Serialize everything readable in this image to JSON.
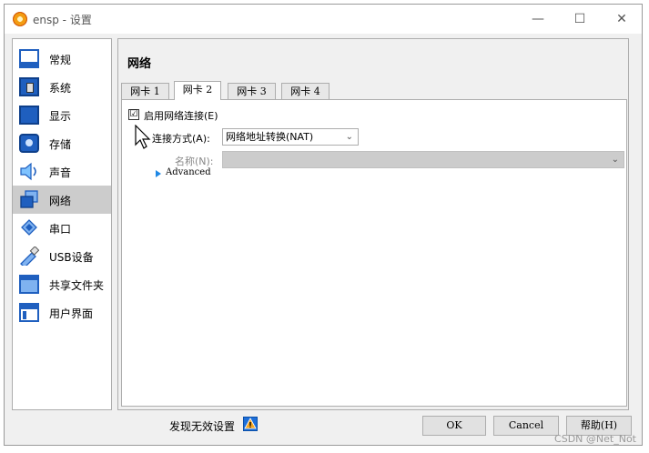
{
  "window": {
    "title": "ensp - 设置",
    "controls": {
      "minimize": "—",
      "maximize": "☐",
      "close": "✕"
    }
  },
  "sidebar": {
    "items": [
      {
        "label": "常规",
        "icon": "general-icon"
      },
      {
        "label": "系统",
        "icon": "system-icon"
      },
      {
        "label": "显示",
        "icon": "display-icon"
      },
      {
        "label": "存储",
        "icon": "storage-icon"
      },
      {
        "label": "声音",
        "icon": "audio-icon"
      },
      {
        "label": "网络",
        "icon": "network-icon",
        "selected": true
      },
      {
        "label": "串口",
        "icon": "serial-port-icon"
      },
      {
        "label": "USB设备",
        "icon": "usb-icon"
      },
      {
        "label": "共享文件夹",
        "icon": "shared-folder-icon"
      },
      {
        "label": "用户界面",
        "icon": "user-interface-icon"
      }
    ]
  },
  "main": {
    "title": "网络",
    "tabs": [
      {
        "label": "网卡 1"
      },
      {
        "label": "网卡 2",
        "active": true
      },
      {
        "label": "网卡 3"
      },
      {
        "label": "网卡 4"
      }
    ],
    "enable_label": "启用网络连接(E)",
    "enable_checked": "☑",
    "attached_label": "连接方式(A):",
    "attached_value": "网络地址转换(NAT)",
    "name_label": "名称(N):",
    "name_value": "",
    "advanced_label": "Advanced"
  },
  "footer": {
    "invalid_settings_label": "发现无效设置",
    "ok_label": "OK",
    "cancel_label": "Cancel",
    "help_label": "帮助(H)"
  },
  "watermark": "CSDN @Net_Not",
  "colors": {
    "accent": "#1e88e5",
    "selected_bg": "#cccccc"
  }
}
